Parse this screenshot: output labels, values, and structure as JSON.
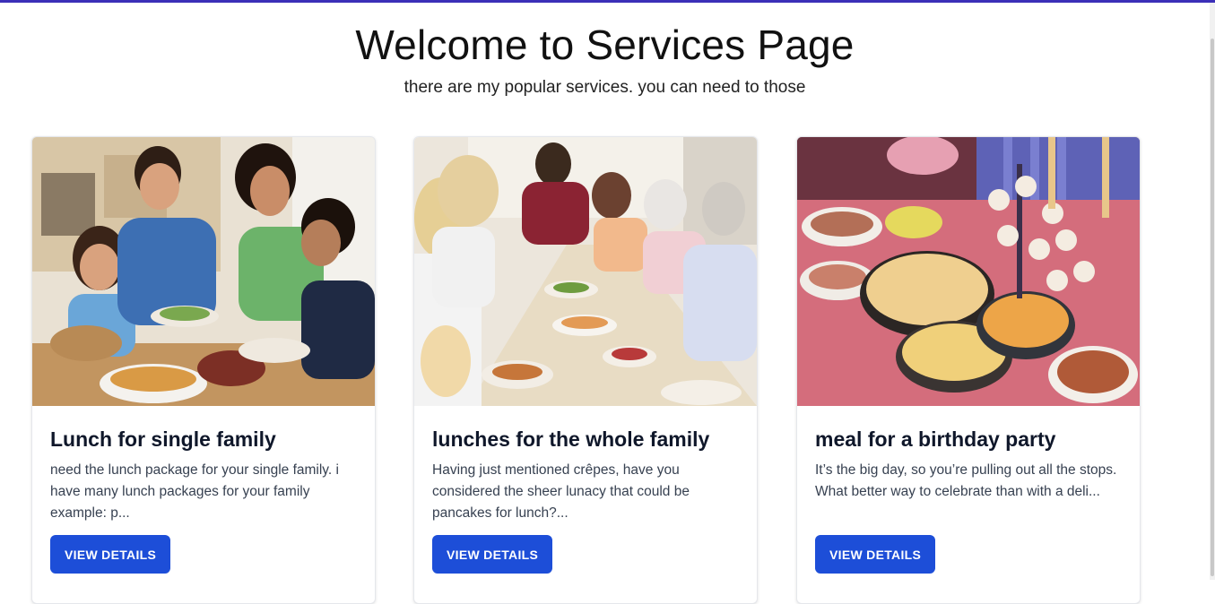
{
  "header": {
    "title": "Welcome to Services Page",
    "subtitle": "there are my popular services. you can need to those"
  },
  "colors": {
    "accent": "#1d4ed8",
    "topbar": "#3b2fb8"
  },
  "cards": [
    {
      "title": "Lunch for single family",
      "description": "need the lunch package for your single family. i have many lunch packages for your family example: p...",
      "button_label": "VIEW DETAILS"
    },
    {
      "title": "lunches for the whole family",
      "description": "Having just mentioned crêpes, have you considered the sheer lunacy that could be pancakes for lunch?...",
      "button_label": "VIEW DETAILS"
    },
    {
      "title": "meal for a birthday party",
      "description": "It’s the big day, so you’re pulling out all the stops. What better way to celebrate than with a deli...",
      "button_label": "VIEW DETAILS"
    }
  ]
}
